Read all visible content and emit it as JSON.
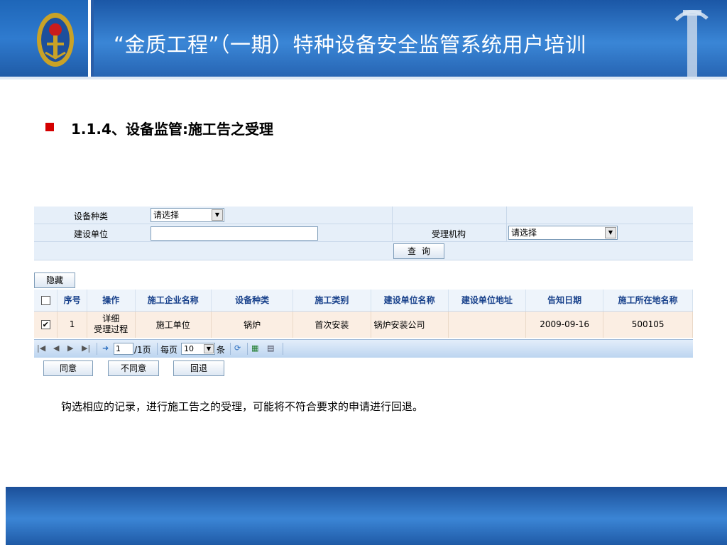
{
  "header": {
    "title": "“金质工程”（一期）特种设备安全监管系统用户培训"
  },
  "section": {
    "heading": "1.1.4、设备监管:施工告之受理"
  },
  "form": {
    "equip_type_label": "设备种类",
    "equip_type_value": "请选择",
    "build_unit_label": "建设单位",
    "build_unit_value": "",
    "accept_org_label": "受理机构",
    "accept_org_value": "请选择",
    "query_label": "查询"
  },
  "hide_label": "隐藏",
  "grid": {
    "headers": [
      "序号",
      "操作",
      "施工企业名称",
      "设备种类",
      "施工类别",
      "建设单位名称",
      "建设单位地址",
      "告知日期",
      "施工所在地名称"
    ],
    "rows": [
      {
        "checked": true,
        "seq": "1",
        "op_detail": "详细",
        "op_process": "受理过程",
        "company": "施工单位",
        "equip_type": "锅炉",
        "category": "首次安装",
        "build_unit": "锅炉安装公司",
        "build_addr": "",
        "date": "2009-09-16",
        "location": "500105"
      }
    ]
  },
  "pager": {
    "page_input": "1",
    "page_total": "/1页",
    "per_page_prefix": "每页",
    "per_page_value": "10",
    "per_page_suffix": "条"
  },
  "actions": {
    "agree": "同意",
    "disagree": "不同意",
    "rollback": "回退"
  },
  "description": "钩选相应的记录，进行施工告之的受理，可能将不符合要求的申请进行回退。",
  "colors": {
    "header_blue": "#2a5ea8",
    "bullet_red": "#d40000",
    "grid_header_text": "#17408b",
    "row_bg": "#fbeee3"
  }
}
